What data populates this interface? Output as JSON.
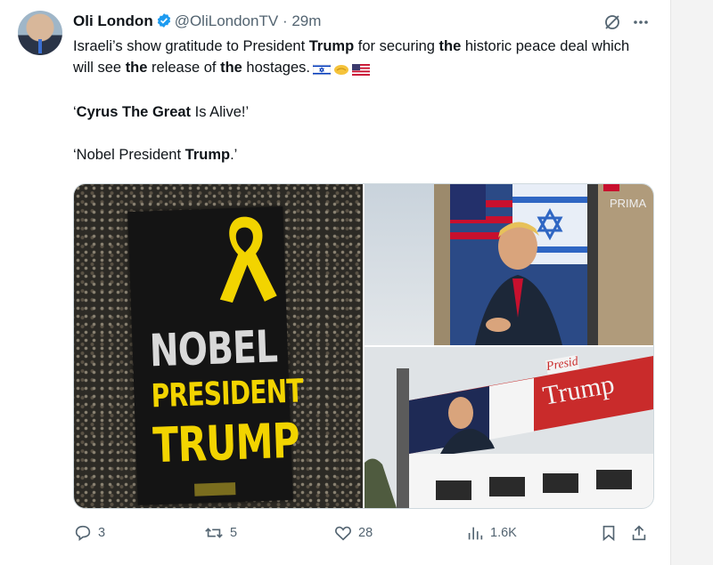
{
  "tweet": {
    "author_name": "Oli London",
    "handle": "@OliLondonTV",
    "separator": "·",
    "time": "29m",
    "line1_a": "Israeli’s show gratitude to President ",
    "line1_b": "Trump",
    "line1_c": " for securing ",
    "line1_d": "the",
    "line1_e": " historic peace deal which will see ",
    "line1_f": "the",
    "line1_g": " release of ",
    "line1_h": "the",
    "line1_i": " hostages.",
    "quote1_a": "‘",
    "quote1_b": "Cyrus The Great",
    "quote1_c": " Is Alive!’",
    "quote2_a": "‘Nobel President ",
    "quote2_b": "Trump",
    "quote2_c": ".’"
  },
  "media": {
    "banner_line1": "NOBEL",
    "banner_line2": "PRESIDENT",
    "banner_line3": "TRUMP",
    "billboard_top_word": "PRIMA",
    "billboard_bottom_word1": "Presid",
    "billboard_bottom_word2": "Trump"
  },
  "actions": {
    "replies": "3",
    "reposts": "5",
    "likes": "28",
    "views": "1.6K"
  },
  "colors": {
    "verified": "#1d9bf0",
    "secondary_text": "#536471",
    "border": "#cfd9de"
  },
  "icons": {
    "verified": "verified-badge-icon",
    "grok": "grok-icon",
    "more": "more-icon",
    "reply": "reply-icon",
    "repost": "repost-icon",
    "like": "heart-icon",
    "views": "views-icon",
    "bookmark": "bookmark-icon",
    "share": "share-icon"
  }
}
